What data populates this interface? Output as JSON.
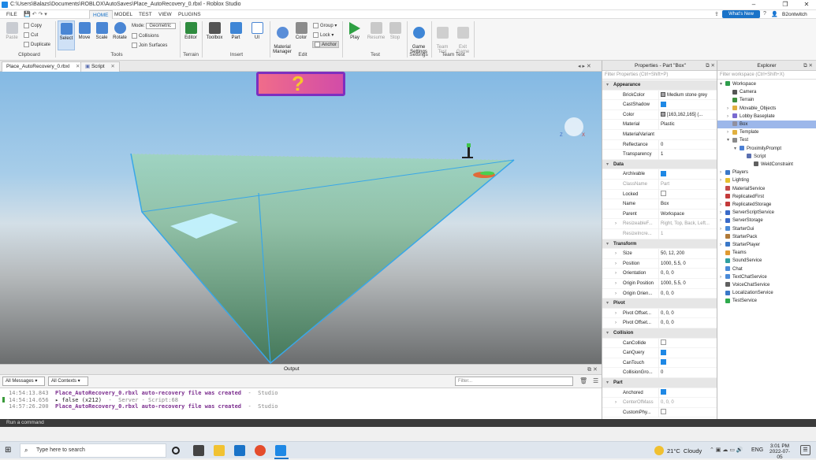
{
  "window": {
    "title": "C:\\Users\\Balazs\\Documents\\ROBLOX\\AutoSaves\\Place_AutoRecovery_0.rbxl - Roblox Studio"
  },
  "menu": {
    "tabs": [
      "FILE",
      "HOME",
      "MODEL",
      "TEST",
      "VIEW",
      "PLUGINS"
    ],
    "active": "HOME",
    "whats_new": "What's New",
    "user": "B2ontwitch"
  },
  "ribbon": {
    "paste": "Paste",
    "copy": "Copy",
    "cut": "Cut",
    "duplicate": "Duplicate",
    "clipboard": "Clipboard",
    "select": "Select",
    "move": "Move",
    "scale": "Scale",
    "rotate": "Rotate",
    "mode_label": "Mode:",
    "mode_value": "Geometric",
    "collisions": "Collisions",
    "join_surfaces": "Join Surfaces",
    "tools": "Tools",
    "editor": "Editor",
    "terrain": "Terrain",
    "toolbox": "Toolbox",
    "part": "Part",
    "ui": "UI",
    "insert": "Insert",
    "material_manager": "Material\nManager",
    "color": "Color",
    "group": "Group",
    "lock": "Lock",
    "anchor": "Anchor",
    "edit": "Edit",
    "play": "Play",
    "resume": "Resume",
    "stop": "Stop",
    "test": "Test",
    "game_settings": "Game\nSettings",
    "settings": "Settings",
    "team_test": "Team\nTest",
    "exit_game": "Exit\nGame",
    "team_test_group": "Team Test"
  },
  "doc_tabs": [
    "Place_AutoRecovery_0.rbxl",
    "Script"
  ],
  "output": {
    "title": "Output",
    "filter_messages": "All Messages",
    "filter_contexts": "All Contexts",
    "filter_placeholder": "Filter...",
    "lines": [
      {
        "time": "14:54:13.843",
        "msg": "Place_AutoRecovery_0.rbxl auto-recovery file was created",
        "src": "Studio"
      },
      {
        "time": "14:54:14.656",
        "msg": "▸ false (x212)",
        "src": "Server - Script:68"
      },
      {
        "time": "14:57:26.200",
        "msg": "Place_AutoRecovery_0.rbxl auto-recovery file was created",
        "src": "Studio"
      }
    ]
  },
  "command_bar": "Run a command",
  "properties": {
    "title": "Properties - Part \"Box\"",
    "filter": "Filter Properties (Ctrl+Shift+P)",
    "rows": [
      {
        "kind": "cat",
        "name": "Appearance"
      },
      {
        "name": "BrickColor",
        "value": "Medium stone grey",
        "swatch": "#a3a2a5"
      },
      {
        "name": "CastShadow",
        "check": true
      },
      {
        "name": "Color",
        "value": "[163,162,165] (...",
        "swatch": "#a3a2a5"
      },
      {
        "name": "Material",
        "value": "Plastic"
      },
      {
        "name": "MaterialVariant",
        "value": ""
      },
      {
        "name": "Reflectance",
        "value": "0"
      },
      {
        "name": "Transparency",
        "value": "1"
      },
      {
        "kind": "cat",
        "name": "Data"
      },
      {
        "name": "Archivable",
        "check": true
      },
      {
        "name": "ClassName",
        "value": "Part",
        "dim": true
      },
      {
        "name": "Locked",
        "check": false
      },
      {
        "name": "Name",
        "value": "Box"
      },
      {
        "name": "Parent",
        "value": "Workspace"
      },
      {
        "name": "ResizeableF...",
        "value": "Right, Top, Back, Left...",
        "dim": true,
        "expand": true
      },
      {
        "name": "ResizeIncre...",
        "value": "1",
        "dim": true
      },
      {
        "kind": "cat",
        "name": "Transform"
      },
      {
        "name": "Size",
        "value": "50, 12, 200",
        "expand": true
      },
      {
        "name": "Position",
        "value": "1000, 5.5, 0",
        "expand": true
      },
      {
        "name": "Orientation",
        "value": "0, 0, 0",
        "expand": true
      },
      {
        "name": "Origin Position",
        "value": "1000, 5.5, 0",
        "expand": true
      },
      {
        "name": "Origin Orien...",
        "value": "0, 0, 0",
        "expand": true
      },
      {
        "kind": "cat",
        "name": "Pivot"
      },
      {
        "name": "Pivot Offset...",
        "value": "0, 0, 0",
        "expand": true
      },
      {
        "name": "Pivot Offset...",
        "value": "0, 0, 0",
        "expand": true
      },
      {
        "kind": "cat",
        "name": "Collision"
      },
      {
        "name": "CanCollide",
        "check": false
      },
      {
        "name": "CanQuery",
        "check": true
      },
      {
        "name": "CanTouch",
        "check": true
      },
      {
        "name": "CollisionGro...",
        "value": "0"
      },
      {
        "kind": "cat",
        "name": "Part"
      },
      {
        "name": "Anchored",
        "check": true
      },
      {
        "name": "CenterOfMass",
        "value": "0, 0, 0",
        "dim": true,
        "expand": true
      },
      {
        "name": "CustomPhy...",
        "check": false
      }
    ]
  },
  "explorer": {
    "title": "Explorer",
    "filter": "Filter workspace (Ctrl+Shift+X)",
    "items": [
      {
        "label": "Workspace",
        "depth": 0,
        "toggle": "v",
        "icon": "#2e9d4c"
      },
      {
        "label": "Camera",
        "depth": 1,
        "toggle": "",
        "icon": "#555555"
      },
      {
        "label": "Terrain",
        "depth": 1,
        "toggle": "",
        "icon": "#3e8f3e"
      },
      {
        "label": "Movable_Objects",
        "depth": 1,
        "toggle": ">",
        "icon": "#e0b040"
      },
      {
        "label": "Lobby Baseplate",
        "depth": 1,
        "toggle": ">",
        "icon": "#7a6ad0"
      },
      {
        "label": "Box",
        "depth": 1,
        "toggle": "",
        "icon": "#9090a0",
        "selected": true
      },
      {
        "label": "Template",
        "depth": 1,
        "toggle": ">",
        "icon": "#e0b040"
      },
      {
        "label": "Test",
        "depth": 1,
        "toggle": "v",
        "icon": "#8a8a8a"
      },
      {
        "label": "ProximityPrompt",
        "depth": 2,
        "toggle": "v",
        "icon": "#4a7fd4"
      },
      {
        "label": "Script",
        "depth": 3,
        "toggle": "",
        "icon": "#5a6fb0"
      },
      {
        "label": "WeldConstraint",
        "depth": 4,
        "toggle": "",
        "icon": "#606060"
      },
      {
        "label": "Players",
        "depth": 0,
        "toggle": ">",
        "icon": "#3a78c8"
      },
      {
        "label": "Lighting",
        "depth": 0,
        "toggle": ">",
        "icon": "#e6c030"
      },
      {
        "label": "MaterialService",
        "depth": 0,
        "toggle": "",
        "icon": "#c44a4a"
      },
      {
        "label": "ReplicatedFirst",
        "depth": 0,
        "toggle": "",
        "icon": "#c43a3a"
      },
      {
        "label": "ReplicatedStorage",
        "depth": 0,
        "toggle": ">",
        "icon": "#c43a3a"
      },
      {
        "label": "ServerScriptService",
        "depth": 0,
        "toggle": ">",
        "icon": "#3a6ac8"
      },
      {
        "label": "ServerStorage",
        "depth": 0,
        "toggle": ">",
        "icon": "#3a6ac8"
      },
      {
        "label": "StarterGui",
        "depth": 0,
        "toggle": ">",
        "icon": "#4a8ad8"
      },
      {
        "label": "StarterPack",
        "depth": 0,
        "toggle": "",
        "icon": "#b07a3a"
      },
      {
        "label": "StarterPlayer",
        "depth": 0,
        "toggle": ">",
        "icon": "#3a78c8"
      },
      {
        "label": "Teams",
        "depth": 0,
        "toggle": "",
        "icon": "#e09a30"
      },
      {
        "label": "SoundService",
        "depth": 0,
        "toggle": "",
        "icon": "#30a0a0"
      },
      {
        "label": "Chat",
        "depth": 0,
        "toggle": "",
        "icon": "#4a8ad8"
      },
      {
        "label": "TextChatService",
        "depth": 0,
        "toggle": ">",
        "icon": "#4a8ad8"
      },
      {
        "label": "VoiceChatService",
        "depth": 0,
        "toggle": "",
        "icon": "#606060"
      },
      {
        "label": "LocalizationService",
        "depth": 0,
        "toggle": "",
        "icon": "#3a78c8"
      },
      {
        "label": "TestService",
        "depth": 0,
        "toggle": "",
        "icon": "#2eaa4c"
      }
    ]
  },
  "taskbar": {
    "search_placeholder": "Type here to search",
    "weather": "21°C  Cloudy",
    "lang": "ENG",
    "time": "3:01 PM",
    "date": "2022-07-05"
  },
  "colors": {
    "accent": "#1a73c8",
    "selection": "#9cb7ea",
    "play_green": "#2ea043"
  }
}
